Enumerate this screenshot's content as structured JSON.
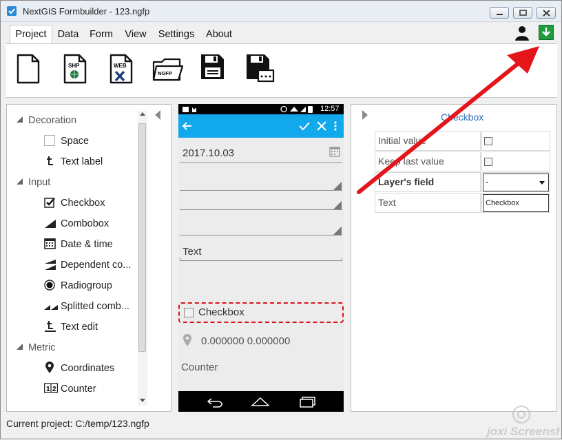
{
  "window": {
    "title": "NextGIS Formbuilder - 123.ngfp"
  },
  "menu": {
    "tabs": [
      {
        "label": "Project",
        "active": true
      },
      {
        "label": "Data"
      },
      {
        "label": "Form"
      },
      {
        "label": "View"
      },
      {
        "label": "Settings"
      },
      {
        "label": "About"
      }
    ]
  },
  "toolbar": {
    "tools": [
      {
        "name": "new-file-icon",
        "badge": ""
      },
      {
        "name": "shp-file-icon",
        "badge": "SHP"
      },
      {
        "name": "web-file-icon",
        "badge": "WEB"
      },
      {
        "name": "ngfp-folder-icon",
        "badge": "NGFP"
      },
      {
        "name": "save-icon",
        "badge": ""
      },
      {
        "name": "save-as-icon",
        "badge": ""
      }
    ]
  },
  "elements_tree": {
    "groups": [
      {
        "label": "Decoration",
        "items": [
          {
            "label": "Space",
            "icon": "space-icon"
          },
          {
            "label": "Text label",
            "icon": "text-label-icon"
          }
        ]
      },
      {
        "label": "Input",
        "items": [
          {
            "label": "Checkbox",
            "icon": "checkbox-icon"
          },
          {
            "label": "Combobox",
            "icon": "combobox-icon"
          },
          {
            "label": "Date & time",
            "icon": "calendar-icon"
          },
          {
            "label": "Dependent co...",
            "icon": "dependent-combobox-icon"
          },
          {
            "label": "Radiogroup",
            "icon": "radio-icon"
          },
          {
            "label": "Splitted comb...",
            "icon": "splitted-combobox-icon"
          },
          {
            "label": "Text edit",
            "icon": "text-edit-icon"
          }
        ]
      },
      {
        "label": "Metric",
        "items": [
          {
            "label": "Coordinates",
            "icon": "location-pin-icon"
          },
          {
            "label": "Counter",
            "icon": "counter-icon"
          }
        ]
      }
    ]
  },
  "phone": {
    "time": "12:57",
    "date_value": "2017.10.03",
    "text_value": "Text",
    "checkbox_label": "Checkbox",
    "coordinates": "0.000000  0.000000",
    "counter_label": "Counter"
  },
  "properties": {
    "title": "Checkbox",
    "rows": [
      {
        "key": "Initial value",
        "type": "checkbox",
        "bold": false
      },
      {
        "key": "Keep last value",
        "type": "checkbox",
        "bold": false
      },
      {
        "key": "Layer's field",
        "type": "combo",
        "value": "-",
        "bold": true
      },
      {
        "key": "Text",
        "type": "text",
        "value": "Checkbox",
        "bold": false
      }
    ]
  },
  "statusbar": {
    "text": "Current project: C:/temp/123.ngfp"
  },
  "colors": {
    "accent_phone": "#11a8ec",
    "annotation": "#e4151b",
    "download_green": "#1f9b3c"
  },
  "watermark": "joxi Screenshot"
}
